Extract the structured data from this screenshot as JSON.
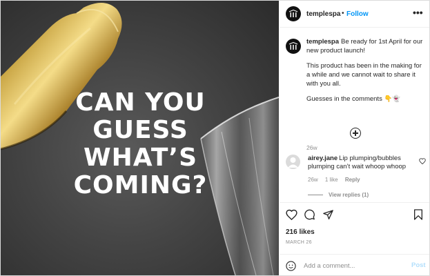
{
  "post": {
    "headline_lines": [
      "CAN YOU",
      "GUESS",
      "WHAT’S",
      "COMING?"
    ],
    "header": {
      "username": "templespa",
      "separator": "•",
      "follow_label": "Follow",
      "more_label": "•••"
    },
    "caption": {
      "username": "templespa",
      "line1": "Be ready for 1st April for our new product launch!",
      "line2": "This product has been in the making for a while and we cannot wait to share it with you all.",
      "line3": "Guesses in the comments 👇👻",
      "time": "26w"
    },
    "comment": {
      "username": "airey.jane",
      "text": "Lip plumping/bubbles plumping can’t wait whoop whoop",
      "time": "26w",
      "likes": "1 like",
      "reply_label": "Reply",
      "view_replies": "View replies (1)"
    },
    "actions": {
      "likes": "216 likes",
      "date": "MARCH 26"
    },
    "add_comment": {
      "placeholder": "Add a comment...",
      "post_label": "Post"
    }
  },
  "colors": {
    "accent": "#0095f6",
    "post_disabled": "#b2dffc",
    "muted": "#8e8e8e",
    "foil_gold": "#c8a443"
  },
  "icons": [
    "heart-icon",
    "comment-icon",
    "share-icon",
    "bookmark-icon",
    "smiley-icon",
    "plus-circle-icon",
    "more-icon"
  ]
}
